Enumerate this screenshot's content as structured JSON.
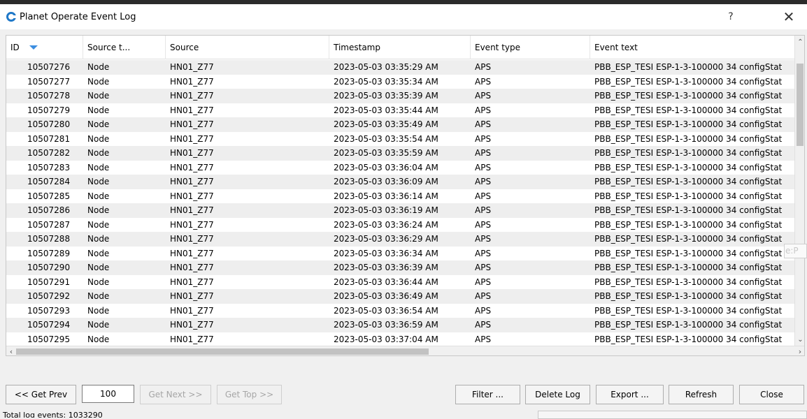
{
  "window": {
    "title": "Planet Operate Event Log",
    "help_label": "?",
    "close_label": "✕"
  },
  "columns": [
    "ID",
    "Source t...",
    "Source",
    "Timestamp",
    "Event type",
    "Event text"
  ],
  "rows": [
    {
      "id": "10507276",
      "source_type": "Node",
      "source": "HN01_Z77",
      "timestamp": "2023-05-03 03:35:29 AM",
      "event_type": "APS",
      "event_text": "PBB_ESP_TESI ESP-1-3-100000 34 configStat"
    },
    {
      "id": "10507277",
      "source_type": "Node",
      "source": "HN01_Z77",
      "timestamp": "2023-05-03 03:35:34 AM",
      "event_type": "APS",
      "event_text": "PBB_ESP_TESI ESP-1-3-100000 34 configStat"
    },
    {
      "id": "10507278",
      "source_type": "Node",
      "source": "HN01_Z77",
      "timestamp": "2023-05-03 03:35:39 AM",
      "event_type": "APS",
      "event_text": "PBB_ESP_TESI ESP-1-3-100000 34 configStat"
    },
    {
      "id": "10507279",
      "source_type": "Node",
      "source": "HN01_Z77",
      "timestamp": "2023-05-03 03:35:44 AM",
      "event_type": "APS",
      "event_text": "PBB_ESP_TESI ESP-1-3-100000 34 configStat"
    },
    {
      "id": "10507280",
      "source_type": "Node",
      "source": "HN01_Z77",
      "timestamp": "2023-05-03 03:35:49 AM",
      "event_type": "APS",
      "event_text": "PBB_ESP_TESI ESP-1-3-100000 34 configStat"
    },
    {
      "id": "10507281",
      "source_type": "Node",
      "source": "HN01_Z77",
      "timestamp": "2023-05-03 03:35:54 AM",
      "event_type": "APS",
      "event_text": "PBB_ESP_TESI ESP-1-3-100000 34 configStat"
    },
    {
      "id": "10507282",
      "source_type": "Node",
      "source": "HN01_Z77",
      "timestamp": "2023-05-03 03:35:59 AM",
      "event_type": "APS",
      "event_text": "PBB_ESP_TESI ESP-1-3-100000 34 configStat"
    },
    {
      "id": "10507283",
      "source_type": "Node",
      "source": "HN01_Z77",
      "timestamp": "2023-05-03 03:36:04 AM",
      "event_type": "APS",
      "event_text": "PBB_ESP_TESI ESP-1-3-100000 34 configStat"
    },
    {
      "id": "10507284",
      "source_type": "Node",
      "source": "HN01_Z77",
      "timestamp": "2023-05-03 03:36:09 AM",
      "event_type": "APS",
      "event_text": "PBB_ESP_TESI ESP-1-3-100000 34 configStat"
    },
    {
      "id": "10507285",
      "source_type": "Node",
      "source": "HN01_Z77",
      "timestamp": "2023-05-03 03:36:14 AM",
      "event_type": "APS",
      "event_text": "PBB_ESP_TESI ESP-1-3-100000 34 configStat"
    },
    {
      "id": "10507286",
      "source_type": "Node",
      "source": "HN01_Z77",
      "timestamp": "2023-05-03 03:36:19 AM",
      "event_type": "APS",
      "event_text": "PBB_ESP_TESI ESP-1-3-100000 34 configStat"
    },
    {
      "id": "10507287",
      "source_type": "Node",
      "source": "HN01_Z77",
      "timestamp": "2023-05-03 03:36:24 AM",
      "event_type": "APS",
      "event_text": "PBB_ESP_TESI ESP-1-3-100000 34 configStat"
    },
    {
      "id": "10507288",
      "source_type": "Node",
      "source": "HN01_Z77",
      "timestamp": "2023-05-03 03:36:29 AM",
      "event_type": "APS",
      "event_text": "PBB_ESP_TESI ESP-1-3-100000 34 configStat"
    },
    {
      "id": "10507289",
      "source_type": "Node",
      "source": "HN01_Z77",
      "timestamp": "2023-05-03 03:36:34 AM",
      "event_type": "APS",
      "event_text": "PBB_ESP_TESI ESP-1-3-100000 34 configStat"
    },
    {
      "id": "10507290",
      "source_type": "Node",
      "source": "HN01_Z77",
      "timestamp": "2023-05-03 03:36:39 AM",
      "event_type": "APS",
      "event_text": "PBB_ESP_TESI ESP-1-3-100000 34 configStat"
    },
    {
      "id": "10507291",
      "source_type": "Node",
      "source": "HN01_Z77",
      "timestamp": "2023-05-03 03:36:44 AM",
      "event_type": "APS",
      "event_text": "PBB_ESP_TESI ESP-1-3-100000 34 configStat"
    },
    {
      "id": "10507292",
      "source_type": "Node",
      "source": "HN01_Z77",
      "timestamp": "2023-05-03 03:36:49 AM",
      "event_type": "APS",
      "event_text": "PBB_ESP_TESI ESP-1-3-100000 34 configStat"
    },
    {
      "id": "10507293",
      "source_type": "Node",
      "source": "HN01_Z77",
      "timestamp": "2023-05-03 03:36:54 AM",
      "event_type": "APS",
      "event_text": "PBB_ESP_TESI ESP-1-3-100000 34 configStat"
    },
    {
      "id": "10507294",
      "source_type": "Node",
      "source": "HN01_Z77",
      "timestamp": "2023-05-03 03:36:59 AM",
      "event_type": "APS",
      "event_text": "PBB_ESP_TESI ESP-1-3-100000 34 configStat"
    },
    {
      "id": "10507295",
      "source_type": "Node",
      "source": "HN01_Z77",
      "timestamp": "2023-05-03 03:37:04 AM",
      "event_type": "APS",
      "event_text": "PBB_ESP_TESI ESP-1-3-100000 34 configStat"
    }
  ],
  "tooltip_fragment": "e:P",
  "toolbar": {
    "get_prev": "<< Get Prev",
    "page_size": "100",
    "get_next": "Get Next >>",
    "get_top": "Get Top >>",
    "filter": "Filter ...",
    "delete_log": "Delete Log",
    "export": "Export ...",
    "refresh": "Refresh",
    "close": "Close"
  },
  "status": {
    "text": "Total log events: 1033290"
  },
  "colors": {
    "accent": "#1f78c8",
    "sort_arrow": "#3c8ee0",
    "row_alt": "#eeeeee"
  }
}
